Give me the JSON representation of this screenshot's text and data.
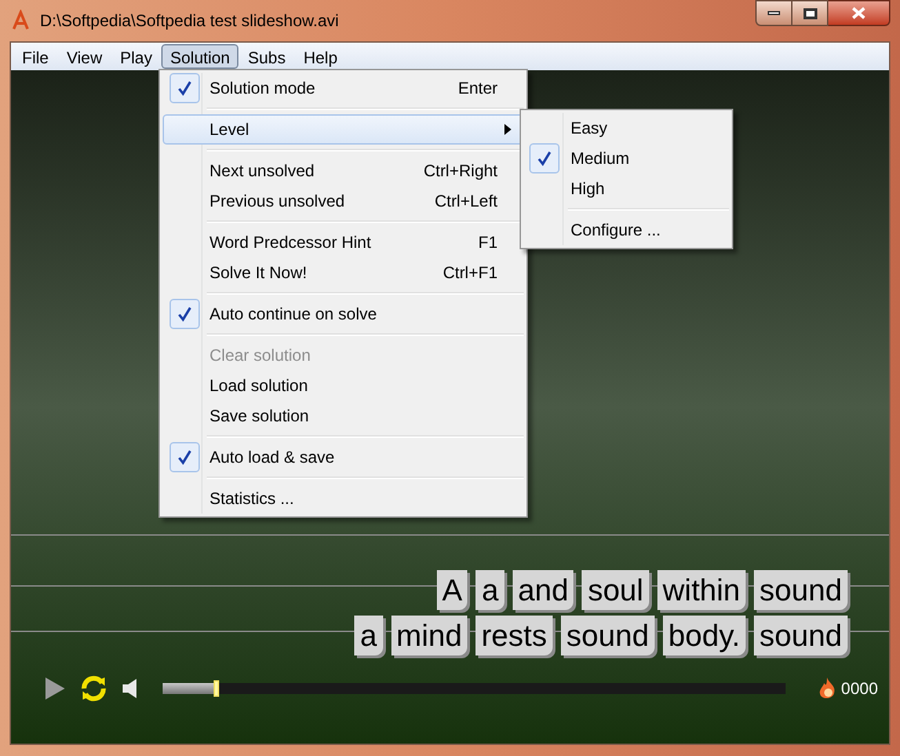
{
  "window": {
    "title": "D:\\Softpedia\\Softpedia test slideshow.avi"
  },
  "menu_bar": [
    {
      "label": "File",
      "selected": false
    },
    {
      "label": "View",
      "selected": false
    },
    {
      "label": "Play",
      "selected": false
    },
    {
      "label": "Solution",
      "selected": true
    },
    {
      "label": "Subs",
      "selected": false
    },
    {
      "label": "Help",
      "selected": false
    }
  ],
  "dropdown": [
    {
      "kind": "item",
      "label": "Solution mode",
      "shortcut": "Enter",
      "checked": true,
      "disabled": false,
      "selected": false,
      "submenu": false
    },
    {
      "kind": "separator"
    },
    {
      "kind": "item",
      "label": "Level",
      "checked": false,
      "disabled": false,
      "selected": true,
      "submenu": true
    },
    {
      "kind": "separator"
    },
    {
      "kind": "item",
      "label": "Next unsolved",
      "shortcut": "Ctrl+Right",
      "checked": false,
      "disabled": false,
      "selected": false,
      "submenu": false
    },
    {
      "kind": "item",
      "label": "Previous unsolved",
      "shortcut": "Ctrl+Left",
      "checked": false,
      "disabled": false,
      "selected": false,
      "submenu": false
    },
    {
      "kind": "separator"
    },
    {
      "kind": "item",
      "label": "Word Predcessor Hint",
      "shortcut": "F1",
      "checked": false,
      "disabled": false,
      "selected": false,
      "submenu": false
    },
    {
      "kind": "item",
      "label": "Solve It Now!",
      "shortcut": "Ctrl+F1",
      "checked": false,
      "disabled": false,
      "selected": false,
      "submenu": false
    },
    {
      "kind": "separator"
    },
    {
      "kind": "item",
      "label": "Auto continue on solve",
      "checked": true,
      "disabled": false,
      "selected": false,
      "submenu": false
    },
    {
      "kind": "separator"
    },
    {
      "kind": "item",
      "label": "Clear solution",
      "checked": false,
      "disabled": true,
      "selected": false,
      "submenu": false
    },
    {
      "kind": "item",
      "label": "Load solution",
      "checked": false,
      "disabled": false,
      "selected": false,
      "submenu": false
    },
    {
      "kind": "item",
      "label": "Save solution",
      "checked": false,
      "disabled": false,
      "selected": false,
      "submenu": false
    },
    {
      "kind": "separator"
    },
    {
      "kind": "item",
      "label": "Auto load & save",
      "checked": true,
      "disabled": false,
      "selected": false,
      "submenu": false
    },
    {
      "kind": "separator"
    },
    {
      "kind": "item",
      "label": "Statistics ...",
      "checked": false,
      "disabled": false,
      "selected": false,
      "submenu": false
    }
  ],
  "submenu": [
    {
      "kind": "item",
      "label": "Easy",
      "checked": false
    },
    {
      "kind": "item",
      "label": "Medium",
      "checked": true
    },
    {
      "kind": "item",
      "label": "High",
      "checked": false
    },
    {
      "kind": "separator"
    },
    {
      "kind": "item",
      "label": "Configure ...",
      "checked": false
    }
  ],
  "subtitles": [
    [
      "A",
      "a",
      "and",
      "soul",
      "within",
      "sound"
    ],
    [
      "a",
      "mind",
      "rests",
      "sound",
      "body.",
      "sound"
    ]
  ],
  "player": {
    "seek": {
      "level": 0.086
    },
    "counter": "0000"
  }
}
